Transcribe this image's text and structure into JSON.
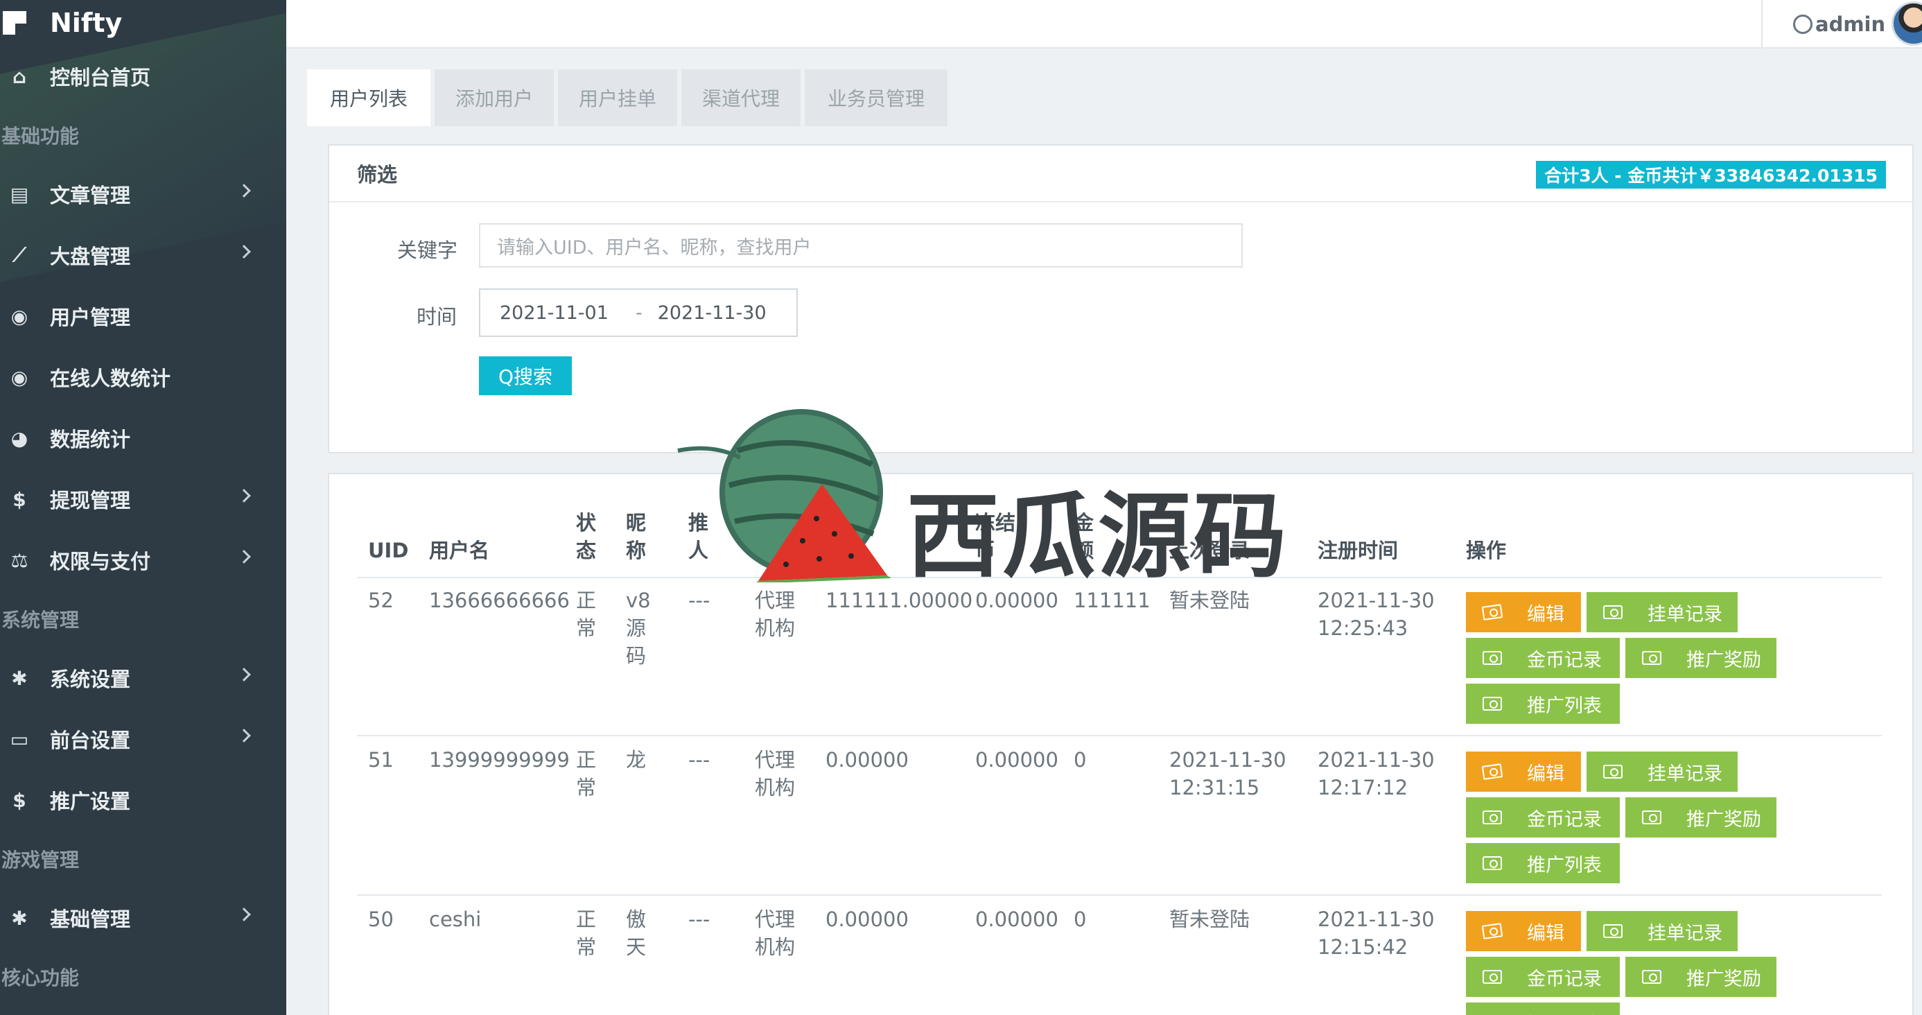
{
  "brand": {
    "name": "Nifty"
  },
  "sidebar": {
    "entries": [
      {
        "kind": "item",
        "icon": "home-icon",
        "glyph": "⌂",
        "label": "控制台首页",
        "chevron": false
      },
      {
        "kind": "section",
        "label": "基础功能"
      },
      {
        "kind": "item",
        "icon": "file-icon",
        "glyph": "▤",
        "label": "文章管理",
        "chevron": true
      },
      {
        "kind": "item",
        "icon": "line-chart-icon",
        "glyph": "⟋",
        "label": "大盘管理",
        "chevron": true
      },
      {
        "kind": "item",
        "icon": "user-circle-icon",
        "glyph": "◉",
        "label": "用户管理",
        "chevron": false
      },
      {
        "kind": "item",
        "icon": "user-circle-icon",
        "glyph": "◉",
        "label": "在线人数统计",
        "chevron": false
      },
      {
        "kind": "item",
        "icon": "pie-chart-icon",
        "glyph": "◕",
        "label": "数据统计",
        "chevron": false
      },
      {
        "kind": "item",
        "icon": "dollar-icon",
        "glyph": "$",
        "label": "提现管理",
        "chevron": true
      },
      {
        "kind": "item",
        "icon": "balance-scale-icon",
        "glyph": "⚖",
        "label": "权限与支付",
        "chevron": true
      },
      {
        "kind": "section",
        "label": "系统管理"
      },
      {
        "kind": "item",
        "icon": "gear-icon",
        "glyph": "✱",
        "label": "系统设置",
        "chevron": true
      },
      {
        "kind": "item",
        "icon": "monitor-icon",
        "glyph": "▭",
        "label": "前台设置",
        "chevron": true
      },
      {
        "kind": "item",
        "icon": "dollar-icon",
        "glyph": "$",
        "label": "推广设置",
        "chevron": false
      },
      {
        "kind": "section",
        "label": "游戏管理"
      },
      {
        "kind": "item",
        "icon": "gear-icon",
        "glyph": "✱",
        "label": "基础管理",
        "chevron": true
      },
      {
        "kind": "section",
        "label": "核心功能"
      }
    ]
  },
  "header": {
    "username": "admin"
  },
  "tabs": [
    "用户列表",
    "添加用户",
    "用户挂单",
    "渠道代理",
    "业务员管理"
  ],
  "filter": {
    "title": "筛选",
    "summary": "合计3人 - 金币共计￥33846342.01315",
    "keyword_label": "关键字",
    "keyword_placeholder": "请输入UID、用户名、昵称，查找用户",
    "time_label": "时间",
    "date_start": "2021-11-01",
    "date_sep": "-",
    "date_end": "2021-11-30",
    "search_label": "Q搜索"
  },
  "table": {
    "headers": {
      "uid": "UID",
      "username": "用户名",
      "status": "状\n态",
      "nickname": "昵\n称",
      "inviter": "推\n人",
      "type": "",
      "balance": "",
      "frozen": "冻结\n币",
      "amount": "金\n额",
      "last_login": "上次登录",
      "reg_time": "注册时间",
      "actions": "操作"
    },
    "rows": [
      {
        "uid": "52",
        "username": "13666666666",
        "status": "正\n常",
        "nickname": "v8\n源\n码",
        "inviter": "---",
        "type": "代理\n机构",
        "balance": "111111.00000",
        "frozen": "0.00000",
        "amount": "111111",
        "last_login": "暂未登陆",
        "reg_time": "2021-11-30\n12:25:43"
      },
      {
        "uid": "51",
        "username": "13999999999",
        "status": "正\n常",
        "nickname": "龙",
        "inviter": "---",
        "type": "代理\n机构",
        "balance": "0.00000",
        "frozen": "0.00000",
        "amount": "0",
        "last_login": "2021-11-30\n12:31:15",
        "reg_time": "2021-11-30\n12:17:12"
      },
      {
        "uid": "50",
        "username": "ceshi",
        "status": "正\n常",
        "nickname": "傲\n天",
        "inviter": "---",
        "type": "代理\n机构",
        "balance": "0.00000",
        "frozen": "0.00000",
        "amount": "0",
        "last_login": "暂未登陆",
        "reg_time": "2021-11-30\n12:15:42"
      }
    ],
    "action_labels": {
      "edit": "编辑",
      "orders": "挂单记录",
      "coins": "金币记录",
      "reward": "推广奖励",
      "promo_list": "推广列表"
    }
  },
  "watermark": {
    "text": "西瓜源码"
  },
  "colors": {
    "sidebar": "#2e3b44",
    "accent": "#0fb7d0",
    "edit": "#f0a21f",
    "action": "#8bc34a"
  }
}
